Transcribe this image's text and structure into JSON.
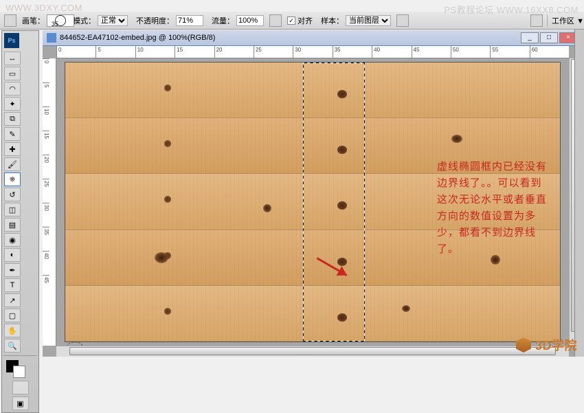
{
  "watermarks": {
    "top_left": "WWW.3DXY.COM",
    "top_right": "PS教程论坛 WWW.16XX8.COM",
    "bottom_brand": "3D学院"
  },
  "options_bar": {
    "brush_label": "画笔：",
    "brush_size": "35",
    "mode_label": "模式：",
    "mode_value": "正常",
    "opacity_label": "不透明度：",
    "opacity_value": "71%",
    "flow_label": "流量：",
    "flow_value": "100%",
    "align_label": "对齐",
    "sample_label": "样本：",
    "sample_value": "当前图层",
    "workspace_label": "工作区 ▼"
  },
  "document": {
    "tab_title": "844652-EA47102-embed.jpg @ 100%(RGB/8)",
    "min": "_",
    "max": "□",
    "close": "×"
  },
  "ruler_h": [
    "0",
    "5",
    "10",
    "15",
    "20",
    "25",
    "30",
    "35",
    "40",
    "45",
    "50",
    "55",
    "60"
  ],
  "ruler_v": [
    "0",
    "5",
    "10",
    "15",
    "20",
    "25",
    "30",
    "35",
    "40",
    "45"
  ],
  "annotation": {
    "text": "虚线椭圆框内已经没有边界线了。。可以看到这次无论水平或者垂直方向的数值设置为多少，都看不到边界线了。"
  },
  "tools": {
    "ps": "Ps",
    "list": [
      "move",
      "marquee",
      "lasso",
      "wand",
      "crop",
      "eyedropper",
      "heal",
      "brush",
      "stamp",
      "history",
      "eraser",
      "gradient",
      "blur",
      "dodge",
      "pen",
      "type",
      "path",
      "shape",
      "hand",
      "zoom"
    ]
  }
}
